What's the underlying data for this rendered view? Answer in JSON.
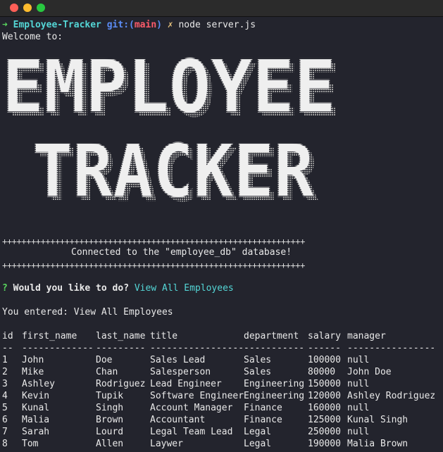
{
  "window": {
    "controls": [
      "close",
      "minimize",
      "zoom"
    ]
  },
  "prompt": {
    "arrow": "➜",
    "dir": "Employee-Tracker",
    "git_label": "git:(",
    "branch": "main",
    "git_close": ")",
    "dirty_mark": "✗",
    "command": "node server.js"
  },
  "welcome": "Welcome to:",
  "banner": {
    "line1": "EMPLOYEE",
    "line2": "TRACKER",
    "colors": {
      "face": "#efefef",
      "shadow": "#a9a9a9"
    }
  },
  "connection": {
    "rule": "+++++++++++++++++++++++++++++++++++++++++++++++++++++++++++++++",
    "message": "Connected to the \"employee_db\" database!"
  },
  "question": {
    "mark": "?",
    "text": "Would you like to do?",
    "answer": "View All Employees"
  },
  "entered": "You entered: View All Employees",
  "table": {
    "headers": [
      "id",
      "first_name",
      "last_name",
      "title",
      "department",
      "salary",
      "manager"
    ],
    "dividers": [
      "--",
      "-------------",
      "---------",
      "-----------------",
      "-----------",
      "------",
      "----------------"
    ],
    "rows": [
      [
        "1",
        "John",
        "Doe",
        "Sales Lead",
        "Sales",
        "100000",
        "null"
      ],
      [
        "2",
        "Mike",
        "Chan",
        "Salesperson",
        "Sales",
        "80000",
        "John Doe"
      ],
      [
        "3",
        "Ashley",
        "Rodriguez",
        "Lead Engineer",
        "Engineering",
        "150000",
        "null"
      ],
      [
        "4",
        "Kevin",
        "Tupik",
        "Software Engineer",
        "Engineering",
        "120000",
        "Ashley Rodriguez"
      ],
      [
        "5",
        "Kunal",
        "Singh",
        "Account Manager",
        "Finance",
        "160000",
        "null"
      ],
      [
        "6",
        "Malia",
        "Brown",
        "Accountant",
        "Finance",
        "125000",
        "Kunal Singh"
      ],
      [
        "7",
        "Sarah",
        "Lourd",
        "Legal Team Lead",
        "Legal",
        "250000",
        "null"
      ],
      [
        "8",
        "Tom",
        "Allen",
        "Laywer",
        "Legal",
        "190000",
        "Malia Brown"
      ]
    ]
  }
}
